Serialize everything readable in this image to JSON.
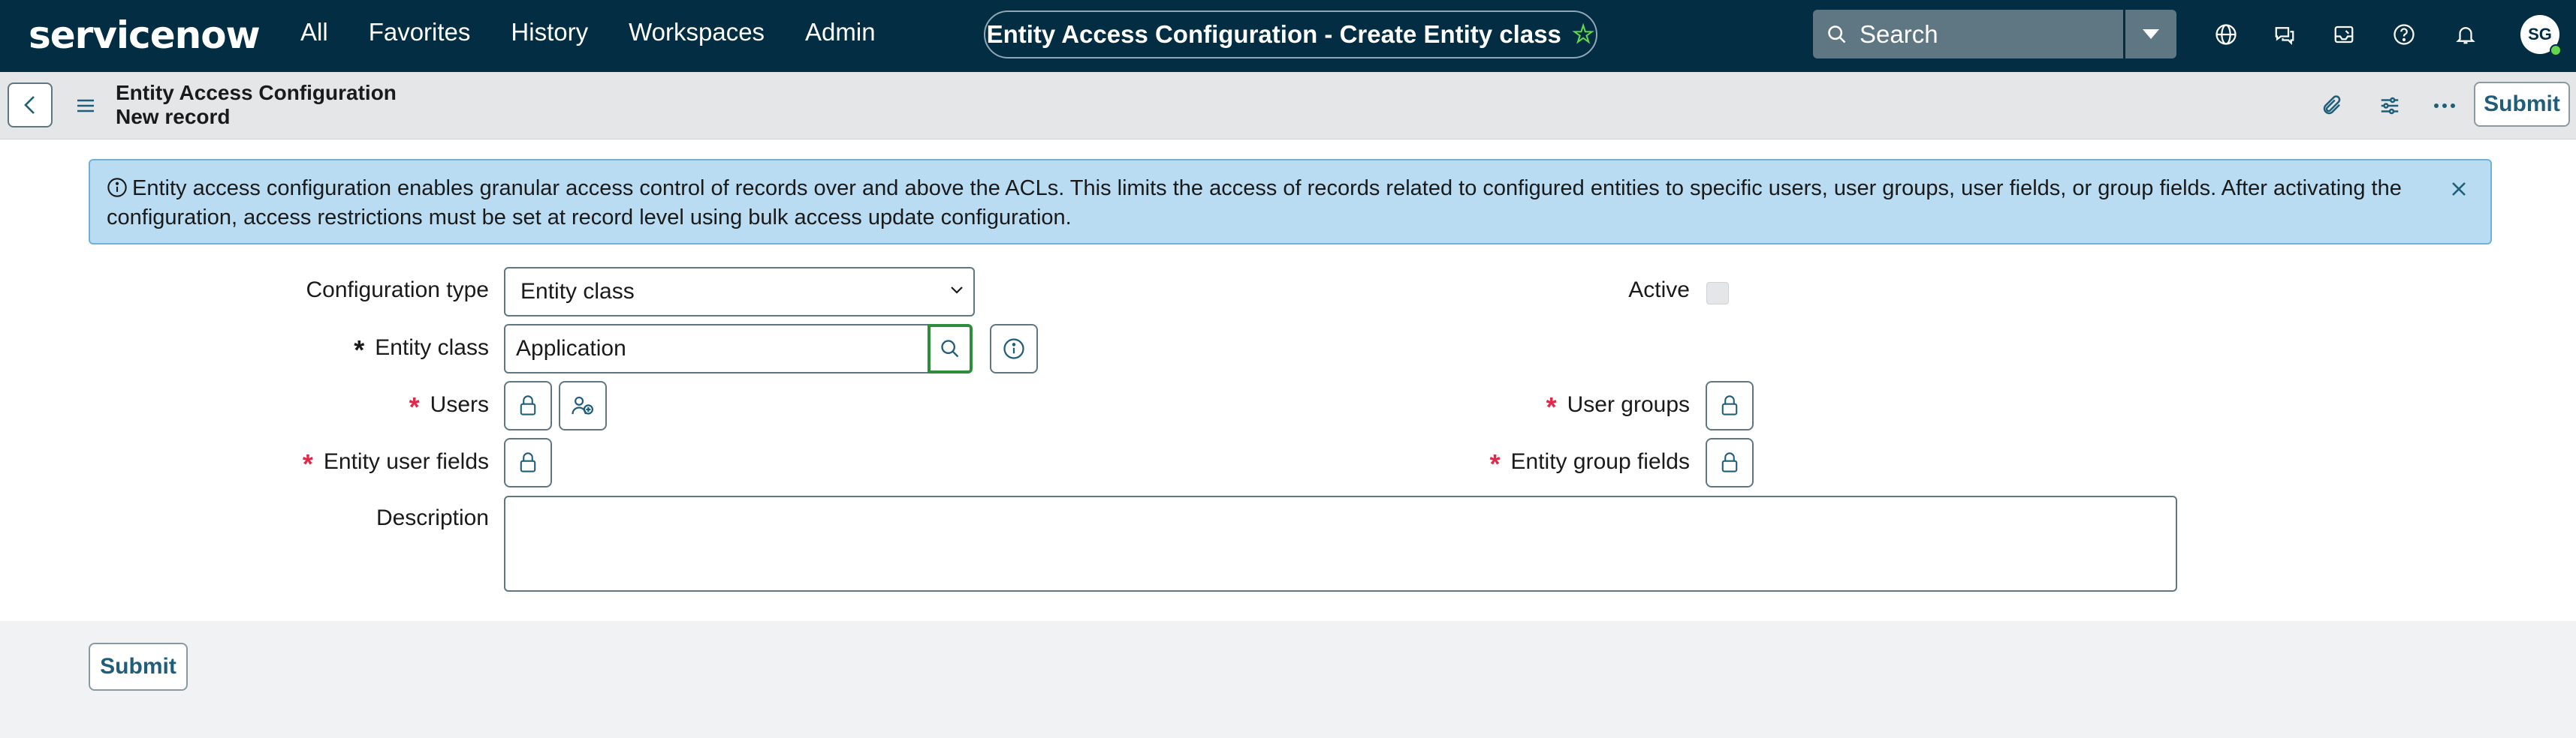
{
  "topnav": {
    "logo": "servicenow",
    "menu": [
      "All",
      "Favorites",
      "History",
      "Workspaces",
      "Admin"
    ],
    "page_title": "Entity Access Configuration - Create Entity class",
    "search_placeholder": "Search",
    "avatar_initials": "SG",
    "icons": [
      "globe-icon",
      "chat-icon",
      "inbox-icon",
      "help-icon",
      "bell-icon"
    ]
  },
  "header": {
    "title": "Entity Access Configuration",
    "subtitle": "New record",
    "submit_label": "Submit",
    "icons": [
      "paperclip-icon",
      "sliders-icon",
      "more-icon"
    ]
  },
  "banner": {
    "text": "Entity access configuration enables granular access control of records over and above the ACLs. This limits the access of records related to configured entities to specific users, user groups, user fields, or group fields. After activating the configuration, access restrictions must be set at record level using bulk access update configuration."
  },
  "form": {
    "configuration_type_label": "Configuration type",
    "configuration_type_value": "Entity class",
    "active_label": "Active",
    "active_checked": false,
    "entity_class_label": "Entity class",
    "entity_class_value": "Application",
    "users_label": "Users",
    "user_groups_label": "User groups",
    "entity_user_fields_label": "Entity user fields",
    "entity_group_fields_label": "Entity group fields",
    "description_label": "Description",
    "description_value": ""
  },
  "footer": {
    "submit_label": "Submit"
  },
  "colors": {
    "nav_bg": "#032d42",
    "accent_green": "#62d84e",
    "required_red": "#e0294a",
    "banner_bg": "#b9dcf2",
    "button_text": "#1f5e7a"
  }
}
